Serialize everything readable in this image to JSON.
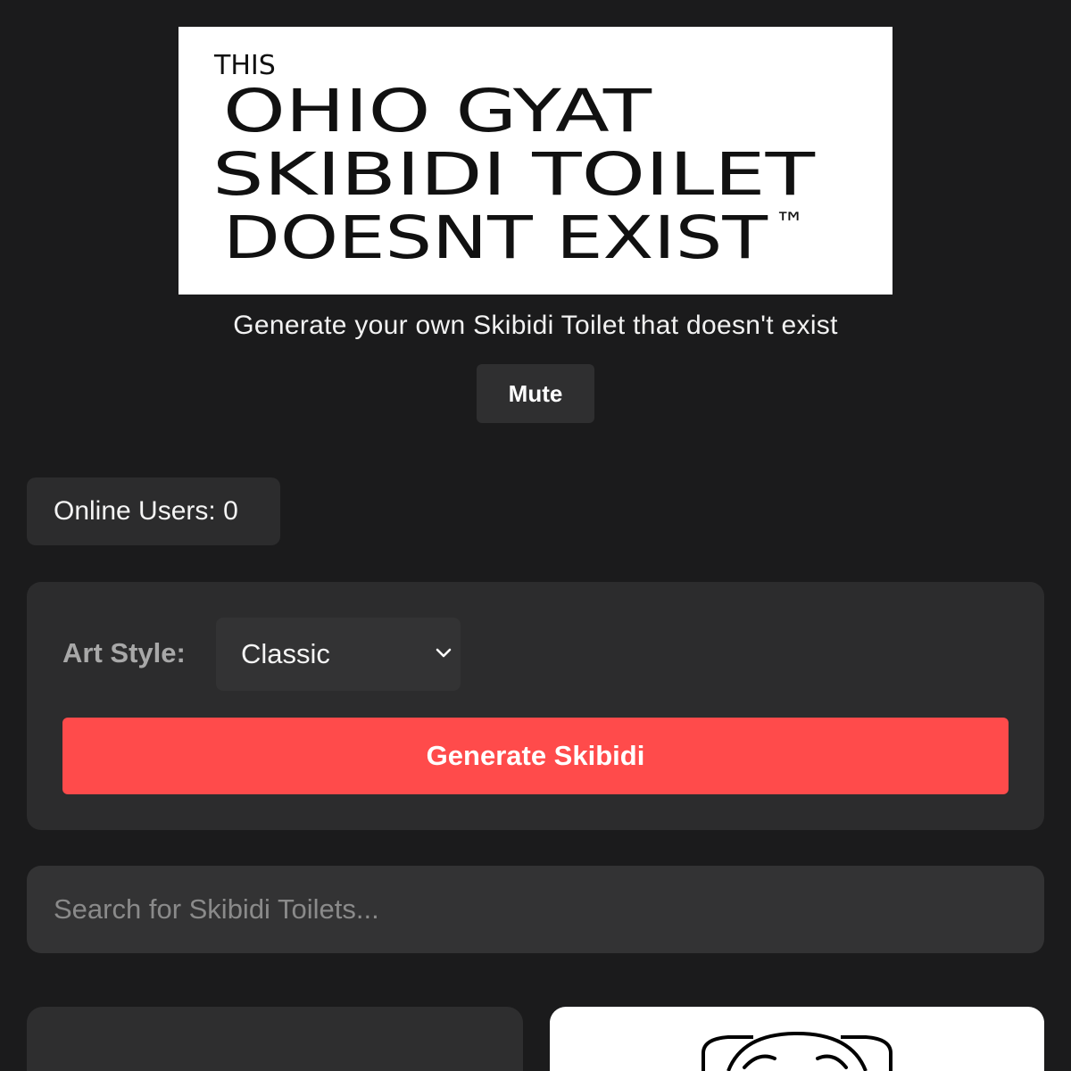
{
  "header": {
    "logo_lines": [
      "THIS",
      "OHIO GYAT",
      "SKIBIDI TOILET",
      "DOESNT EXIST",
      "™"
    ],
    "subtitle": "Generate your own Skibidi Toilet that doesn't exist",
    "mute_label": "Mute"
  },
  "status": {
    "online_users": "Online Users: 0"
  },
  "generator": {
    "art_style_label": "Art Style:",
    "art_style_value": "Classic",
    "generate_label": "Generate Skibidi"
  },
  "search": {
    "placeholder": "Search for Skibidi Toilets..."
  },
  "colors": {
    "background": "#1b1b1c",
    "panel": "#2c2c2d",
    "accent": "#ff4b4b"
  },
  "icons": {
    "select_arrow": "chevron-down-icon"
  }
}
